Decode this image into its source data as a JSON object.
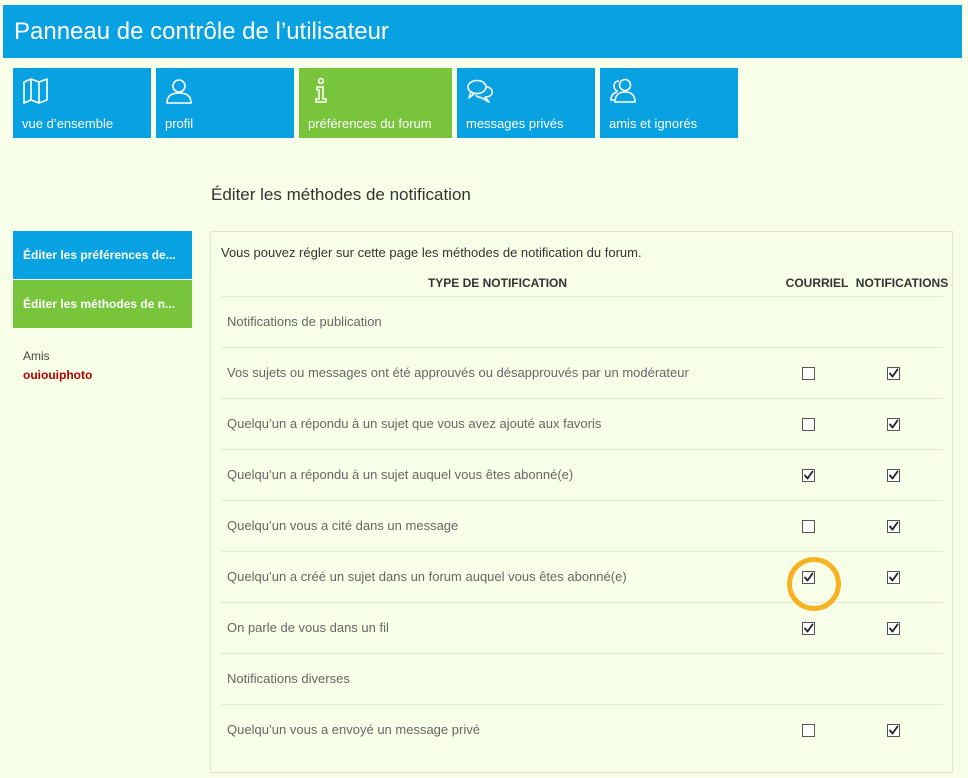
{
  "header": {
    "title": "Panneau de contrôle de l’utilisateur"
  },
  "tiles": [
    {
      "label": "vue d’ensemble",
      "icon": "map-icon"
    },
    {
      "label": "profil",
      "icon": "user-icon"
    },
    {
      "label": "préférences du forum",
      "icon": "info-icon",
      "active": true
    },
    {
      "label": "messages privés",
      "icon": "chat-bubbles-icon"
    },
    {
      "label": "amis et ignorés",
      "icon": "users-icon"
    }
  ],
  "section_title": "Éditer les méthodes de notification",
  "sidebar": {
    "items": [
      {
        "label": "Éditer les préférences de..."
      },
      {
        "label": "Éditer les méthodes de n..."
      }
    ],
    "friends_label": "Amis",
    "friend_name": "ouiouiphoto"
  },
  "panel": {
    "intro": "Vous pouvez régler sur cette page les méthodes de notification du forum.",
    "columns": {
      "type": "TYPE DE NOTIFICATION",
      "mail": "COURRIEL",
      "notifications": "NOTIFICATIONS"
    },
    "rows": [
      {
        "label": "Notifications de publication",
        "group": true
      },
      {
        "label": "Vos sujets ou messages ont été approuvés ou désapprouvés par un modérateur",
        "mail": false,
        "notif": true
      },
      {
        "label": "Quelqu’un a répondu à un sujet que vous avez ajouté aux favoris",
        "mail": false,
        "notif": true
      },
      {
        "label": "Quelqu’un a répondu à un sujet auquel vous êtes abonné(e)",
        "mail": true,
        "notif": true
      },
      {
        "label": "Quelqu’un vous a cité dans un message",
        "mail": false,
        "notif": true
      },
      {
        "label": "Quelqu’un a créé un sujet dans un forum auquel vous êtes abonné(e)",
        "mail": true,
        "notif": true,
        "highlighted": true
      },
      {
        "label": "On parle de vous dans un fil",
        "mail": true,
        "notif": true
      },
      {
        "label": "Notifications diverses",
        "group": true
      },
      {
        "label": "Quelqu’un vous a envoyé un message privé",
        "mail": false,
        "notif": true
      }
    ]
  },
  "colors": {
    "blue": "#08a1e1",
    "green": "#78c43a",
    "background": "#f8ffe8",
    "highlight": "#f5a400",
    "friend": "#b00000"
  }
}
